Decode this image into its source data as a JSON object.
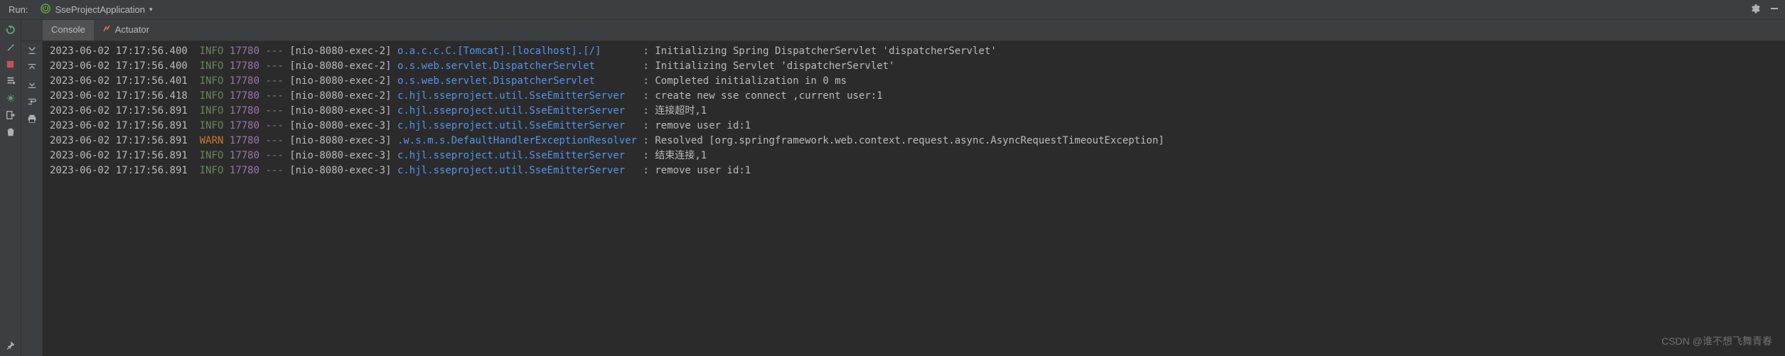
{
  "header": {
    "run_label": "Run:",
    "config_name": "SseProjectApplication"
  },
  "tabs": {
    "console": "Console",
    "actuator": "Actuator"
  },
  "logs": [
    {
      "ts": "2023-06-02 17:17:56.400",
      "level": "INFO",
      "pid": "17780",
      "thread": "[nio-8080-exec-2]",
      "logger": "o.a.c.c.C.[Tomcat].[localhost].[/]      ",
      "msg": "Initializing Spring DispatcherServlet 'dispatcherServlet'"
    },
    {
      "ts": "2023-06-02 17:17:56.400",
      "level": "INFO",
      "pid": "17780",
      "thread": "[nio-8080-exec-2]",
      "logger": "o.s.web.servlet.DispatcherServlet       ",
      "msg": "Initializing Servlet 'dispatcherServlet'"
    },
    {
      "ts": "2023-06-02 17:17:56.401",
      "level": "INFO",
      "pid": "17780",
      "thread": "[nio-8080-exec-2]",
      "logger": "o.s.web.servlet.DispatcherServlet       ",
      "msg": "Completed initialization in 0 ms"
    },
    {
      "ts": "2023-06-02 17:17:56.418",
      "level": "INFO",
      "pid": "17780",
      "thread": "[nio-8080-exec-2]",
      "logger": "c.hjl.sseproject.util.SseEmitterServer  ",
      "msg": "create new sse connect ,current user:1"
    },
    {
      "ts": "2023-06-02 17:17:56.891",
      "level": "INFO",
      "pid": "17780",
      "thread": "[nio-8080-exec-3]",
      "logger": "c.hjl.sseproject.util.SseEmitterServer  ",
      "msg": "连接超时,1"
    },
    {
      "ts": "2023-06-02 17:17:56.891",
      "level": "INFO",
      "pid": "17780",
      "thread": "[nio-8080-exec-3]",
      "logger": "c.hjl.sseproject.util.SseEmitterServer  ",
      "msg": "remove user id:1"
    },
    {
      "ts": "2023-06-02 17:17:56.891",
      "level": "WARN",
      "pid": "17780",
      "thread": "[nio-8080-exec-3]",
      "logger": ".w.s.m.s.DefaultHandlerExceptionResolver",
      "msg": "Resolved [org.springframework.web.context.request.async.AsyncRequestTimeoutException]"
    },
    {
      "ts": "2023-06-02 17:17:56.891",
      "level": "INFO",
      "pid": "17780",
      "thread": "[nio-8080-exec-3]",
      "logger": "c.hjl.sseproject.util.SseEmitterServer  ",
      "msg": "结束连接,1"
    },
    {
      "ts": "2023-06-02 17:17:56.891",
      "level": "INFO",
      "pid": "17780",
      "thread": "[nio-8080-exec-3]",
      "logger": "c.hjl.sseproject.util.SseEmitterServer  ",
      "msg": "remove user id:1"
    }
  ],
  "watermark": "CSDN @谁不想飞舞青春"
}
